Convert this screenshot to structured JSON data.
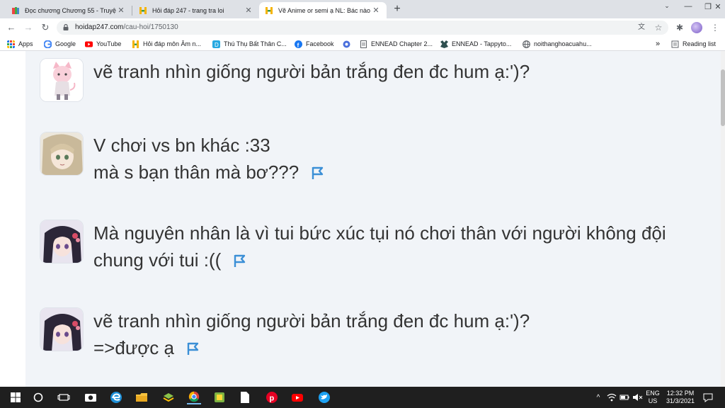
{
  "browser": {
    "tabs": [
      {
        "title": "Đọc chương Chương 55 - Truyện",
        "icon": "book-icon",
        "active": false
      },
      {
        "title": "Hỏi đáp 247 - trang tra loi",
        "icon": "hoidap-logo-icon",
        "active": false
      },
      {
        "title": "Vẽ Anime or semi ạ NL: Bác nào t",
        "icon": "hoidap-logo-icon",
        "active": true
      }
    ],
    "new_tab": "+",
    "window_controls": {
      "minimize": "—",
      "restore": "❐",
      "close": "✕"
    },
    "url_host": "hoidap247.com",
    "url_path": "/cau-hoi/1750130",
    "bookmarks": [
      {
        "label": "Apps",
        "icon": "apps-grid-icon"
      },
      {
        "label": "Google",
        "icon": "google-icon"
      },
      {
        "label": "YouTube",
        "icon": "youtube-icon"
      },
      {
        "label": "Hỏi đáp môn Âm n...",
        "icon": "hoidap-logo-icon"
      },
      {
        "label": "Thú Thụ Bất Thân C...",
        "icon": "d-logo-icon"
      },
      {
        "label": "Facebook",
        "icon": "facebook-icon"
      },
      {
        "label": "",
        "icon": "extension-icon"
      },
      {
        "label": "ENNEAD Chapter 2...",
        "icon": "page-icon"
      },
      {
        "label": "ENNEAD - Tappyto...",
        "icon": "tappytoon-icon"
      },
      {
        "label": "noithanghoacuahu...",
        "icon": "globe-icon"
      }
    ],
    "bookmarks_overflow": "»",
    "reading_list": "Reading list"
  },
  "comments": [
    {
      "lines": [
        "vẽ tranh nhìn giống người bản trắng đen đc hum ạ:')?"
      ],
      "avatar": "pink-cat-avatar",
      "flag": false
    },
    {
      "lines": [
        "V chơi vs bn khác :33",
        "mà s bạn thân mà bơ???"
      ],
      "avatar": "anime-girl-avatar",
      "flag": true
    },
    {
      "lines": [
        "Mà nguyên nhân là vì tui bức xúc tụi nó chơi thân với người không đội",
        "chung với tui :(("
      ],
      "avatar": "anime-dark-hair-avatar",
      "flag": true
    },
    {
      "lines": [
        "vẽ tranh nhìn giống người bản trắng đen đc hum ạ:')?",
        "=>được ạ"
      ],
      "avatar": "anime-dark-hair-avatar",
      "flag": true
    }
  ],
  "taskbar": {
    "language": "ENG",
    "region": "US",
    "time": "12:32 PM",
    "date": "31/3/2021"
  },
  "colors": {
    "panel_bg": "#f1f4f8",
    "flag_blue": "#3b8fd6",
    "text": "#333333",
    "taskbar": "#1f1f1f"
  }
}
